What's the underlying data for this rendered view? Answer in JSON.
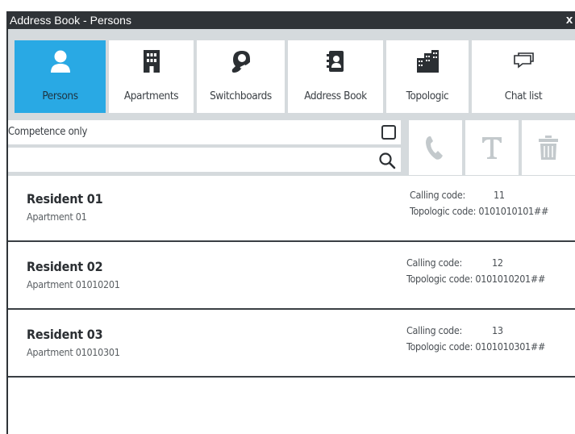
{
  "window": {
    "title": "Address Book - Persons",
    "close_label": "x"
  },
  "tabs": [
    {
      "label": "Persons",
      "icon": "person-icon",
      "active": true
    },
    {
      "label": "Apartments",
      "icon": "building-icon",
      "active": false
    },
    {
      "label": "Switchboards",
      "icon": "headset-icon",
      "active": false
    },
    {
      "label": "Address Book",
      "icon": "address-book-icon",
      "active": false
    },
    {
      "label": "Topologic",
      "icon": "buildings-icon",
      "active": false
    },
    {
      "label": "Chat list",
      "icon": "chat-icon",
      "active": false
    }
  ],
  "filters": {
    "competence_label": "Competence only",
    "competence_checked": false,
    "search_value": "",
    "search_placeholder": ""
  },
  "actions": [
    {
      "name": "call",
      "icon": "phone-icon"
    },
    {
      "name": "text",
      "icon": "text-icon"
    },
    {
      "name": "delete",
      "icon": "trash-icon"
    }
  ],
  "labels": {
    "calling_code": "Calling code:",
    "topologic_code": "Topologic code:"
  },
  "persons": [
    {
      "name": "Resident 01",
      "apartment": "Apartment 01",
      "calling_code": "11",
      "topologic_code": "0101010101##"
    },
    {
      "name": "Resident 02",
      "apartment": "Apartment 01010201",
      "calling_code": "12",
      "topologic_code": "0101010201##"
    },
    {
      "name": "Resident 03",
      "apartment": "Apartment 01010301",
      "calling_code": "13",
      "topologic_code": "0101010301##"
    }
  ],
  "colors": {
    "accent": "#29a9e4",
    "dark": "#2f3337",
    "panel": "#d5dadd",
    "muted_icon": "#c3c9cc"
  }
}
